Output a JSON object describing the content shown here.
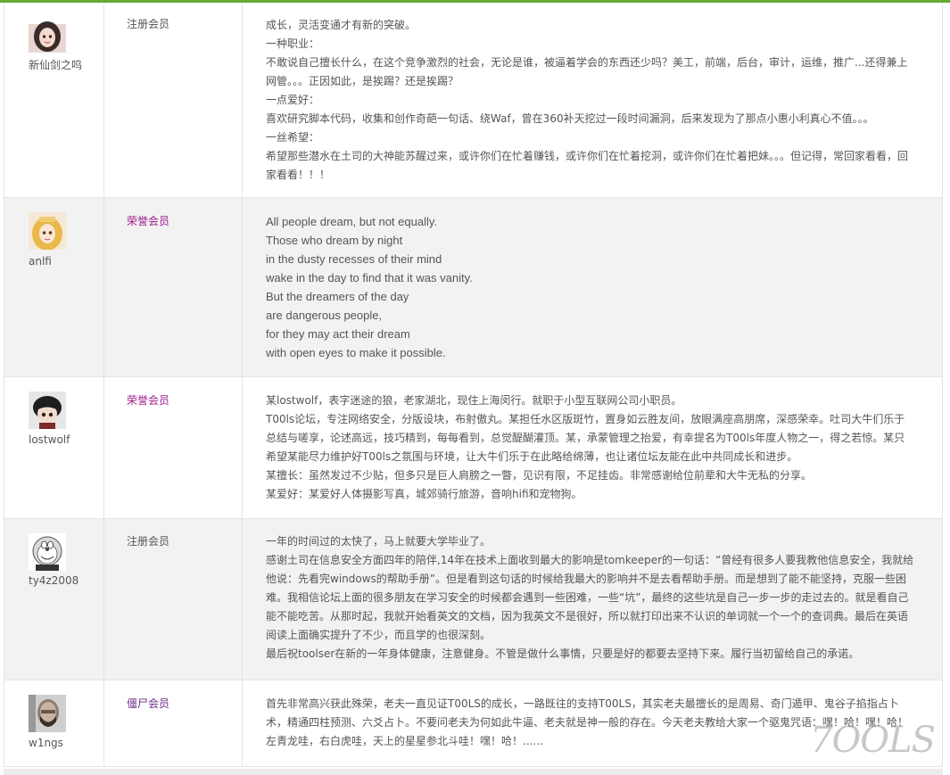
{
  "header": {
    "accent": "#66aa33"
  },
  "rows": [
    {
      "username": "新仙剑之呜",
      "role": "注册会员",
      "avatar": "anime-girl-avatar",
      "lines": [
        "成长，灵活变通才有新的突破。",
        "一种职业：",
        "不敢说自己擅长什么，在这个竞争激烈的社会，无论是谁，被逼着学会的东西还少吗？美工，前端，后台，审计，运维，推广...还得兼上网管。。。正因如此，是挨踢？还是挨踢？",
        "一点爱好：",
        "喜欢研究脚本代码，收集和创作奇葩一句话、绕Waf，曾在360补天挖过一段时间漏洞，后来发现为了那点小惠小利真心不值。。。",
        "一丝希望：",
        "希望那些潜水在土司的大神能苏醒过来，或许你们在忙着赚钱，或许你们在忙着挖洞，或许你们在忙着把妹。。。但记得，常回家看看，回家看看！！！"
      ]
    },
    {
      "username": "anlfi",
      "role": "荣誉会员",
      "avatar": "anime-blonde-avatar",
      "lines": [
        "All people dream, but not equally.",
        "Those who dream by night",
        "in the dusty recesses of their mind",
        "wake in the day to find that it was vanity.",
        "But the dreamers of the day",
        "are dangerous people,",
        "for they may act their dream",
        "with open eyes to make it possible."
      ]
    },
    {
      "username": "lostwolf",
      "role": "荣誉会员",
      "avatar": "cartoon-boy-avatar",
      "lines": [
        "某lostwolf，表字迷途的狼，老家湖北，现住上海闵行。就职于小型互联网公司小职员。",
        "T00ls论坛，专注网络安全，分版设块，布射傲丸。某担任水区版斑竹，置身如云胜友间，放眼满座高朋席，深感荣幸。吐司大牛们乐于总结与嗟享，论述高远，技巧精到，每每看到，总觉醍醐灌顶。某，承蒙管理之抬爱，有幸提名为T00ls年度人物之一，得之若惊。某只希望某能尽力维护好T00ls之氛围与环境，让大牛们乐于在此略给绵薄，也让诸位坛友能在此中共同成长和进步。",
        "某擅长：虽然发过不少贴，但多只是巨人肩膀之一瞥，见识有限，不足挂齿。非常感谢给位前辈和大牛无私的分享。",
        "某爱好：某爱好人体摄影写真，城郊骑行旅游，音响hifi和宠物狗。"
      ]
    },
    {
      "username": "ty4z2008",
      "role": "注册会员",
      "avatar": "doraemon-avatar",
      "lines": [
        "一年的时间过的太快了，马上就要大学毕业了。",
        "感谢土司在信息安全方面四年的陪伴,14年在技术上面收到最大的影响是tomkeeper的一句话：“曾经有很多人要我教他信息安全，我就给他说：先看完windows的帮助手册”。但是看到这句话的时候给我最大的影响并不是去看帮助手册。而是想到了能不能坚持，克服一些困难。我相信论坛上面的很多朋友在学习安全的时候都会遇到一些困难，一些“坑”，最终的这些坑是自己一步一步的走过去的。就是看自己能不能吃苦。从那时起，我就开始看英文的文档，因为我英文不是很好，所以就打印出来不认识的单词就一个一个的查词典。最后在英语阅读上面确实提升了不少，而且学的也很深刻。",
        "最后祝toolser在新的一年身体健康，注意健身。不管是做什么事情，只要是好的都要去坚持下来。履行当初留给自己的承诺。"
      ]
    },
    {
      "username": "w1ngs",
      "role": "僵尸会员",
      "avatar": "bearded-man-avatar",
      "lines": [
        "首先非常高兴获此殊荣，老夫一直见证T00LS的成长，一路既往的支持T00LS，其实老夫最擅长的是周易、奇门遁甲、鬼谷子掐指占卜术，精通四柱预测、六爻占卜。不要问老夫为何如此牛逼、老夫就是神一般的存在。今天老夫教给大家一个驱鬼咒语：嘿！哈！嘿！哈！左青龙哇，右白虎哇，天上的星星参北斗哇！嘿！哈！......"
      ]
    }
  ],
  "watermark": "7OOLS"
}
